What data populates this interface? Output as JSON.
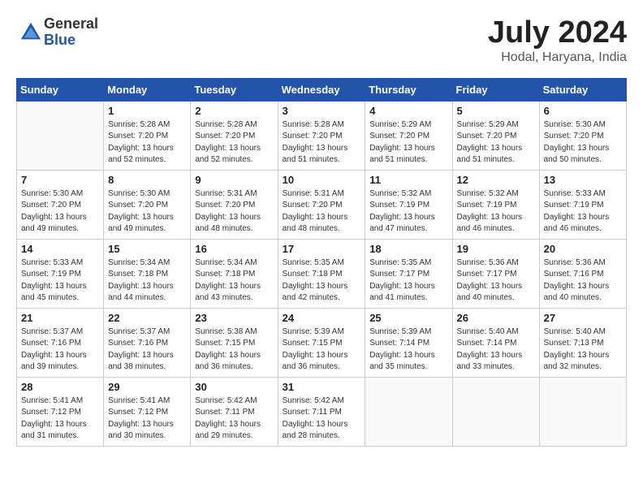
{
  "logo": {
    "general": "General",
    "blue": "Blue"
  },
  "title": "July 2024",
  "location": "Hodal, Haryana, India",
  "days_header": [
    "Sunday",
    "Monday",
    "Tuesday",
    "Wednesday",
    "Thursday",
    "Friday",
    "Saturday"
  ],
  "weeks": [
    [
      {
        "day": "",
        "info": ""
      },
      {
        "day": "1",
        "info": "Sunrise: 5:28 AM\nSunset: 7:20 PM\nDaylight: 13 hours\nand 52 minutes."
      },
      {
        "day": "2",
        "info": "Sunrise: 5:28 AM\nSunset: 7:20 PM\nDaylight: 13 hours\nand 52 minutes."
      },
      {
        "day": "3",
        "info": "Sunrise: 5:28 AM\nSunset: 7:20 PM\nDaylight: 13 hours\nand 51 minutes."
      },
      {
        "day": "4",
        "info": "Sunrise: 5:29 AM\nSunset: 7:20 PM\nDaylight: 13 hours\nand 51 minutes."
      },
      {
        "day": "5",
        "info": "Sunrise: 5:29 AM\nSunset: 7:20 PM\nDaylight: 13 hours\nand 51 minutes."
      },
      {
        "day": "6",
        "info": "Sunrise: 5:30 AM\nSunset: 7:20 PM\nDaylight: 13 hours\nand 50 minutes."
      }
    ],
    [
      {
        "day": "7",
        "info": "Sunrise: 5:30 AM\nSunset: 7:20 PM\nDaylight: 13 hours\nand 49 minutes."
      },
      {
        "day": "8",
        "info": "Sunrise: 5:30 AM\nSunset: 7:20 PM\nDaylight: 13 hours\nand 49 minutes."
      },
      {
        "day": "9",
        "info": "Sunrise: 5:31 AM\nSunset: 7:20 PM\nDaylight: 13 hours\nand 48 minutes."
      },
      {
        "day": "10",
        "info": "Sunrise: 5:31 AM\nSunset: 7:20 PM\nDaylight: 13 hours\nand 48 minutes."
      },
      {
        "day": "11",
        "info": "Sunrise: 5:32 AM\nSunset: 7:19 PM\nDaylight: 13 hours\nand 47 minutes."
      },
      {
        "day": "12",
        "info": "Sunrise: 5:32 AM\nSunset: 7:19 PM\nDaylight: 13 hours\nand 46 minutes."
      },
      {
        "day": "13",
        "info": "Sunrise: 5:33 AM\nSunset: 7:19 PM\nDaylight: 13 hours\nand 46 minutes."
      }
    ],
    [
      {
        "day": "14",
        "info": "Sunrise: 5:33 AM\nSunset: 7:19 PM\nDaylight: 13 hours\nand 45 minutes."
      },
      {
        "day": "15",
        "info": "Sunrise: 5:34 AM\nSunset: 7:18 PM\nDaylight: 13 hours\nand 44 minutes."
      },
      {
        "day": "16",
        "info": "Sunrise: 5:34 AM\nSunset: 7:18 PM\nDaylight: 13 hours\nand 43 minutes."
      },
      {
        "day": "17",
        "info": "Sunrise: 5:35 AM\nSunset: 7:18 PM\nDaylight: 13 hours\nand 42 minutes."
      },
      {
        "day": "18",
        "info": "Sunrise: 5:35 AM\nSunset: 7:17 PM\nDaylight: 13 hours\nand 41 minutes."
      },
      {
        "day": "19",
        "info": "Sunrise: 5:36 AM\nSunset: 7:17 PM\nDaylight: 13 hours\nand 40 minutes."
      },
      {
        "day": "20",
        "info": "Sunrise: 5:36 AM\nSunset: 7:16 PM\nDaylight: 13 hours\nand 40 minutes."
      }
    ],
    [
      {
        "day": "21",
        "info": "Sunrise: 5:37 AM\nSunset: 7:16 PM\nDaylight: 13 hours\nand 39 minutes."
      },
      {
        "day": "22",
        "info": "Sunrise: 5:37 AM\nSunset: 7:16 PM\nDaylight: 13 hours\nand 38 minutes."
      },
      {
        "day": "23",
        "info": "Sunrise: 5:38 AM\nSunset: 7:15 PM\nDaylight: 13 hours\nand 36 minutes."
      },
      {
        "day": "24",
        "info": "Sunrise: 5:39 AM\nSunset: 7:15 PM\nDaylight: 13 hours\nand 36 minutes."
      },
      {
        "day": "25",
        "info": "Sunrise: 5:39 AM\nSunset: 7:14 PM\nDaylight: 13 hours\nand 35 minutes."
      },
      {
        "day": "26",
        "info": "Sunrise: 5:40 AM\nSunset: 7:14 PM\nDaylight: 13 hours\nand 33 minutes."
      },
      {
        "day": "27",
        "info": "Sunrise: 5:40 AM\nSunset: 7:13 PM\nDaylight: 13 hours\nand 32 minutes."
      }
    ],
    [
      {
        "day": "28",
        "info": "Sunrise: 5:41 AM\nSunset: 7:12 PM\nDaylight: 13 hours\nand 31 minutes."
      },
      {
        "day": "29",
        "info": "Sunrise: 5:41 AM\nSunset: 7:12 PM\nDaylight: 13 hours\nand 30 minutes."
      },
      {
        "day": "30",
        "info": "Sunrise: 5:42 AM\nSunset: 7:11 PM\nDaylight: 13 hours\nand 29 minutes."
      },
      {
        "day": "31",
        "info": "Sunrise: 5:42 AM\nSunset: 7:11 PM\nDaylight: 13 hours\nand 28 minutes."
      },
      {
        "day": "",
        "info": ""
      },
      {
        "day": "",
        "info": ""
      },
      {
        "day": "",
        "info": ""
      }
    ]
  ]
}
